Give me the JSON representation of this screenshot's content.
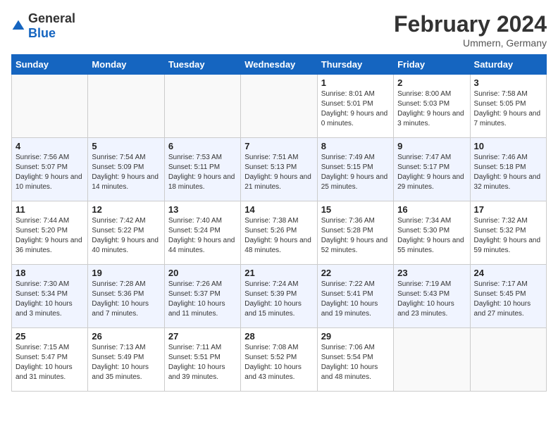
{
  "header": {
    "logo_general": "General",
    "logo_blue": "Blue",
    "month_title": "February 2024",
    "location": "Ummern, Germany"
  },
  "days_of_week": [
    "Sunday",
    "Monday",
    "Tuesday",
    "Wednesday",
    "Thursday",
    "Friday",
    "Saturday"
  ],
  "weeks": [
    [
      {
        "day": "",
        "sunrise": "",
        "sunset": "",
        "daylight": ""
      },
      {
        "day": "",
        "sunrise": "",
        "sunset": "",
        "daylight": ""
      },
      {
        "day": "",
        "sunrise": "",
        "sunset": "",
        "daylight": ""
      },
      {
        "day": "",
        "sunrise": "",
        "sunset": "",
        "daylight": ""
      },
      {
        "day": "1",
        "sunrise": "Sunrise: 8:01 AM",
        "sunset": "Sunset: 5:01 PM",
        "daylight": "Daylight: 9 hours and 0 minutes."
      },
      {
        "day": "2",
        "sunrise": "Sunrise: 8:00 AM",
        "sunset": "Sunset: 5:03 PM",
        "daylight": "Daylight: 9 hours and 3 minutes."
      },
      {
        "day": "3",
        "sunrise": "Sunrise: 7:58 AM",
        "sunset": "Sunset: 5:05 PM",
        "daylight": "Daylight: 9 hours and 7 minutes."
      }
    ],
    [
      {
        "day": "4",
        "sunrise": "Sunrise: 7:56 AM",
        "sunset": "Sunset: 5:07 PM",
        "daylight": "Daylight: 9 hours and 10 minutes."
      },
      {
        "day": "5",
        "sunrise": "Sunrise: 7:54 AM",
        "sunset": "Sunset: 5:09 PM",
        "daylight": "Daylight: 9 hours and 14 minutes."
      },
      {
        "day": "6",
        "sunrise": "Sunrise: 7:53 AM",
        "sunset": "Sunset: 5:11 PM",
        "daylight": "Daylight: 9 hours and 18 minutes."
      },
      {
        "day": "7",
        "sunrise": "Sunrise: 7:51 AM",
        "sunset": "Sunset: 5:13 PM",
        "daylight": "Daylight: 9 hours and 21 minutes."
      },
      {
        "day": "8",
        "sunrise": "Sunrise: 7:49 AM",
        "sunset": "Sunset: 5:15 PM",
        "daylight": "Daylight: 9 hours and 25 minutes."
      },
      {
        "day": "9",
        "sunrise": "Sunrise: 7:47 AM",
        "sunset": "Sunset: 5:17 PM",
        "daylight": "Daylight: 9 hours and 29 minutes."
      },
      {
        "day": "10",
        "sunrise": "Sunrise: 7:46 AM",
        "sunset": "Sunset: 5:18 PM",
        "daylight": "Daylight: 9 hours and 32 minutes."
      }
    ],
    [
      {
        "day": "11",
        "sunrise": "Sunrise: 7:44 AM",
        "sunset": "Sunset: 5:20 PM",
        "daylight": "Daylight: 9 hours and 36 minutes."
      },
      {
        "day": "12",
        "sunrise": "Sunrise: 7:42 AM",
        "sunset": "Sunset: 5:22 PM",
        "daylight": "Daylight: 9 hours and 40 minutes."
      },
      {
        "day": "13",
        "sunrise": "Sunrise: 7:40 AM",
        "sunset": "Sunset: 5:24 PM",
        "daylight": "Daylight: 9 hours and 44 minutes."
      },
      {
        "day": "14",
        "sunrise": "Sunrise: 7:38 AM",
        "sunset": "Sunset: 5:26 PM",
        "daylight": "Daylight: 9 hours and 48 minutes."
      },
      {
        "day": "15",
        "sunrise": "Sunrise: 7:36 AM",
        "sunset": "Sunset: 5:28 PM",
        "daylight": "Daylight: 9 hours and 52 minutes."
      },
      {
        "day": "16",
        "sunrise": "Sunrise: 7:34 AM",
        "sunset": "Sunset: 5:30 PM",
        "daylight": "Daylight: 9 hours and 55 minutes."
      },
      {
        "day": "17",
        "sunrise": "Sunrise: 7:32 AM",
        "sunset": "Sunset: 5:32 PM",
        "daylight": "Daylight: 9 hours and 59 minutes."
      }
    ],
    [
      {
        "day": "18",
        "sunrise": "Sunrise: 7:30 AM",
        "sunset": "Sunset: 5:34 PM",
        "daylight": "Daylight: 10 hours and 3 minutes."
      },
      {
        "day": "19",
        "sunrise": "Sunrise: 7:28 AM",
        "sunset": "Sunset: 5:36 PM",
        "daylight": "Daylight: 10 hours and 7 minutes."
      },
      {
        "day": "20",
        "sunrise": "Sunrise: 7:26 AM",
        "sunset": "Sunset: 5:37 PM",
        "daylight": "Daylight: 10 hours and 11 minutes."
      },
      {
        "day": "21",
        "sunrise": "Sunrise: 7:24 AM",
        "sunset": "Sunset: 5:39 PM",
        "daylight": "Daylight: 10 hours and 15 minutes."
      },
      {
        "day": "22",
        "sunrise": "Sunrise: 7:22 AM",
        "sunset": "Sunset: 5:41 PM",
        "daylight": "Daylight: 10 hours and 19 minutes."
      },
      {
        "day": "23",
        "sunrise": "Sunrise: 7:19 AM",
        "sunset": "Sunset: 5:43 PM",
        "daylight": "Daylight: 10 hours and 23 minutes."
      },
      {
        "day": "24",
        "sunrise": "Sunrise: 7:17 AM",
        "sunset": "Sunset: 5:45 PM",
        "daylight": "Daylight: 10 hours and 27 minutes."
      }
    ],
    [
      {
        "day": "25",
        "sunrise": "Sunrise: 7:15 AM",
        "sunset": "Sunset: 5:47 PM",
        "daylight": "Daylight: 10 hours and 31 minutes."
      },
      {
        "day": "26",
        "sunrise": "Sunrise: 7:13 AM",
        "sunset": "Sunset: 5:49 PM",
        "daylight": "Daylight: 10 hours and 35 minutes."
      },
      {
        "day": "27",
        "sunrise": "Sunrise: 7:11 AM",
        "sunset": "Sunset: 5:51 PM",
        "daylight": "Daylight: 10 hours and 39 minutes."
      },
      {
        "day": "28",
        "sunrise": "Sunrise: 7:08 AM",
        "sunset": "Sunset: 5:52 PM",
        "daylight": "Daylight: 10 hours and 43 minutes."
      },
      {
        "day": "29",
        "sunrise": "Sunrise: 7:06 AM",
        "sunset": "Sunset: 5:54 PM",
        "daylight": "Daylight: 10 hours and 48 minutes."
      },
      {
        "day": "",
        "sunrise": "",
        "sunset": "",
        "daylight": ""
      },
      {
        "day": "",
        "sunrise": "",
        "sunset": "",
        "daylight": ""
      }
    ]
  ]
}
